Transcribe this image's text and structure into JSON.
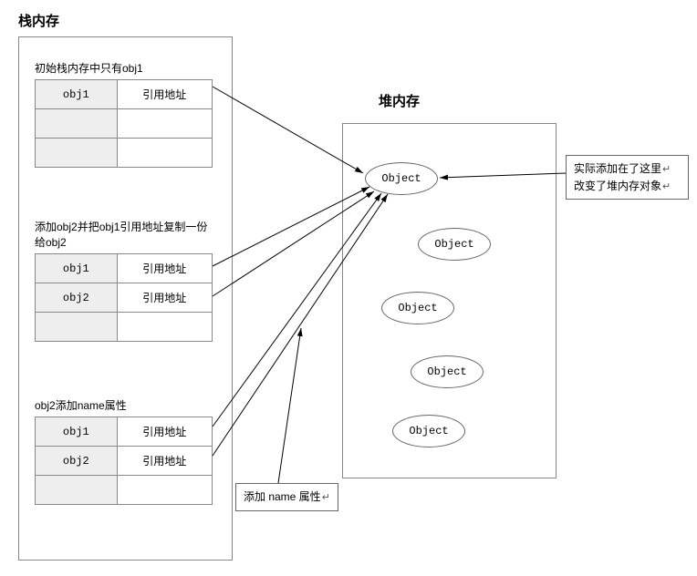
{
  "titles": {
    "stack": "栈内存",
    "heap": "堆内存"
  },
  "block1": {
    "caption": "初始栈内存中只有obj1",
    "rows": [
      {
        "var": "obj1",
        "val": "引用地址"
      },
      {
        "var": "",
        "val": ""
      },
      {
        "var": "",
        "val": ""
      }
    ]
  },
  "block2": {
    "caption": "添加obj2并把obj1引用地址复制一份给obj2",
    "rows": [
      {
        "var": "obj1",
        "val": "引用地址"
      },
      {
        "var": "obj2",
        "val": "引用地址"
      },
      {
        "var": "",
        "val": ""
      }
    ]
  },
  "block3": {
    "caption": "obj2添加name属性",
    "rows": [
      {
        "var": "obj1",
        "val": "引用地址"
      },
      {
        "var": "obj2",
        "val": "引用地址"
      },
      {
        "var": "",
        "val": ""
      }
    ]
  },
  "heap_objects": [
    "Object",
    "Object",
    "Object",
    "Object",
    "Object"
  ],
  "notes": {
    "right_line1": "实际添加在了这里",
    "right_line2": "改变了堆内存对象",
    "add_name": "添加 name 属性"
  }
}
